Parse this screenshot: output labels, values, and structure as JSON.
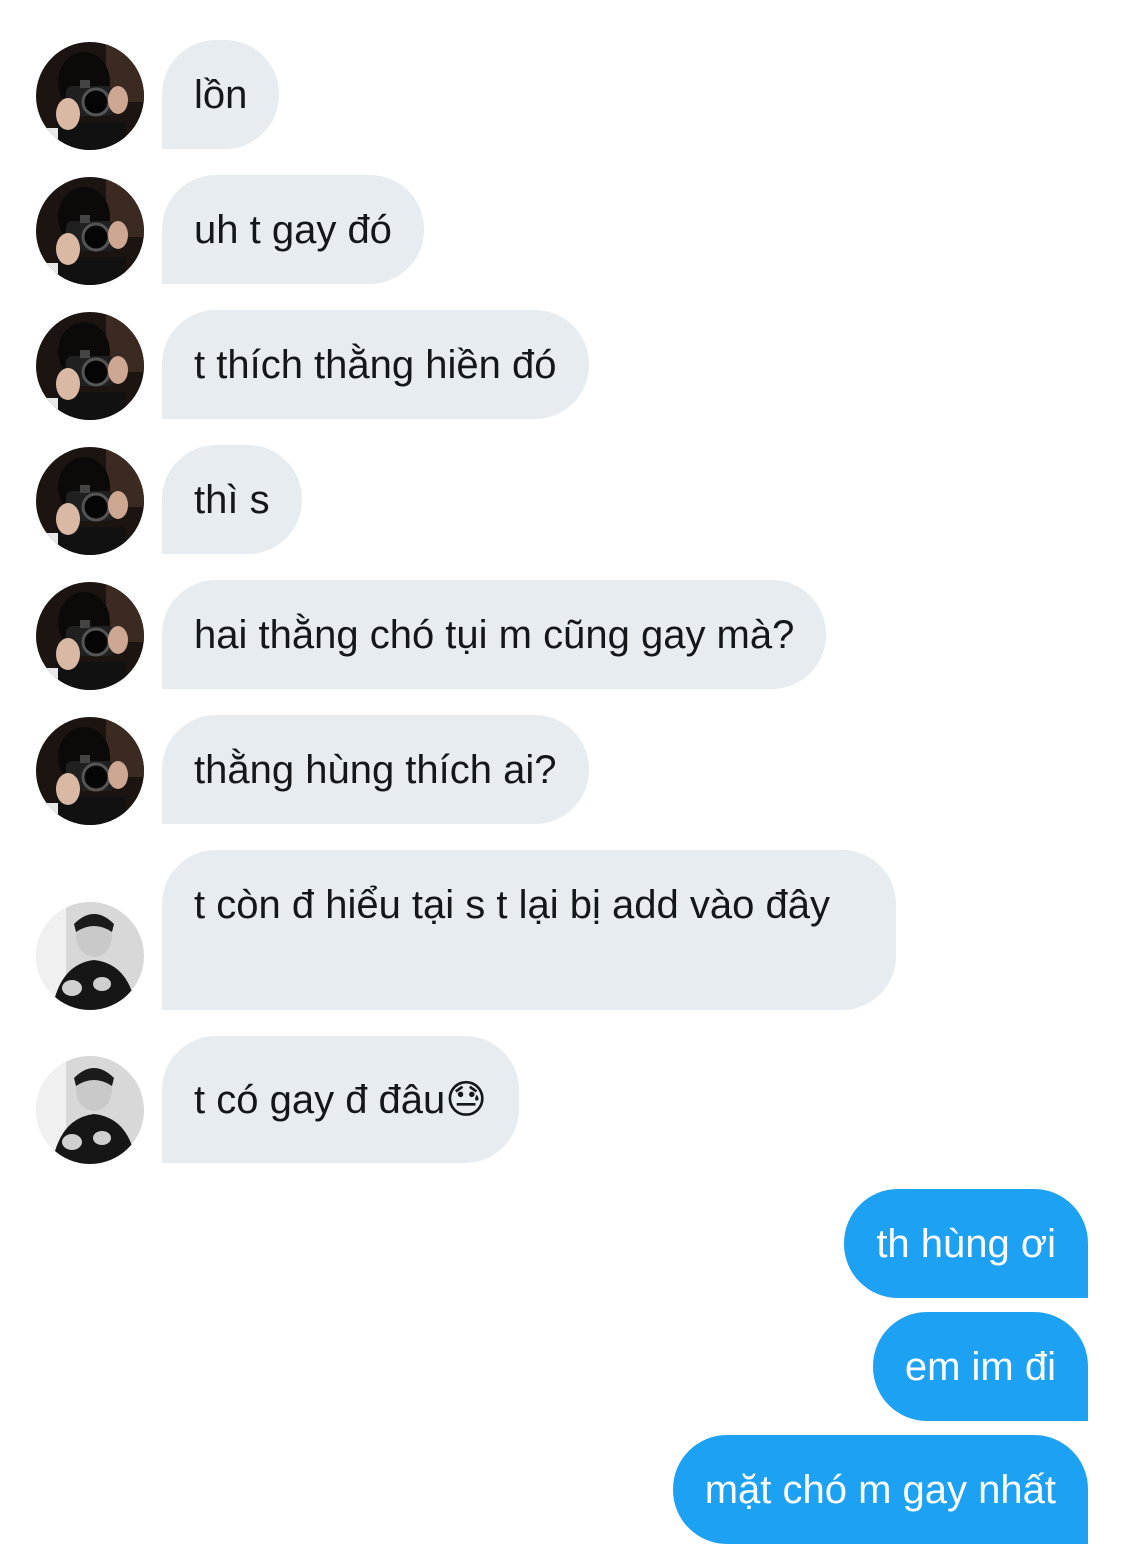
{
  "messages": {
    "m1": "lồn",
    "m2": "uh t gay đó",
    "m3": "t thích thằng hiền đó",
    "m4": "thì s",
    "m5": "hai thằng chó tụi m cũng gay mà?",
    "m6": "thằng hùng thích ai?",
    "m7": "t còn đ hiểu tại s t lại bị add vào đây",
    "m8": "t có gay đ đâu",
    "m8_emoji": "😓",
    "m9": "th hùng ơi",
    "m10": "em im đi",
    "m11": "mặt chó m gay nhất"
  },
  "colors": {
    "incoming_bubble": "#e6ecf0",
    "outgoing_bubble": "#1da1f2",
    "incoming_text": "#14171a",
    "outgoing_text": "#ffffff"
  },
  "avatars": {
    "sender_a": "camera-person-avatar",
    "sender_b": "monochrome-person-avatar"
  }
}
